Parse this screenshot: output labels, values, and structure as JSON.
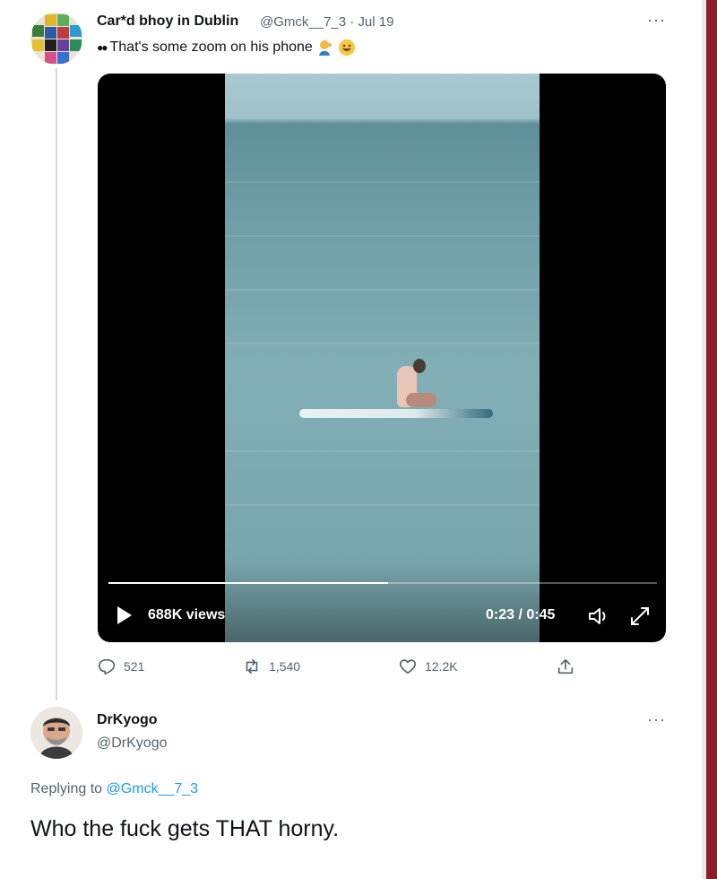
{
  "tweet": {
    "author_name": "Car*d bhoy in Dublin",
    "handle_date": "@Gmck__7_3 · Jul 19",
    "text": "That's some zoom on his phone",
    "more": "···",
    "video": {
      "views": "688K views",
      "time": "0:23 / 0:45",
      "progress_fraction": 0.51
    },
    "actions": {
      "replies": "521",
      "retweets": "1,540",
      "likes": "12.2K"
    }
  },
  "reply": {
    "author_name": "DrKyogo",
    "handle": "@DrKyogo",
    "more": "···",
    "replying_prefix": "Replying to",
    "replying_to": "@Gmck__7_3",
    "text": "Who the fuck gets THAT horny."
  },
  "colors": {
    "accent": "#1d9bf0",
    "secondary_text": "#536471",
    "side_bar": "#8a1f2a"
  }
}
